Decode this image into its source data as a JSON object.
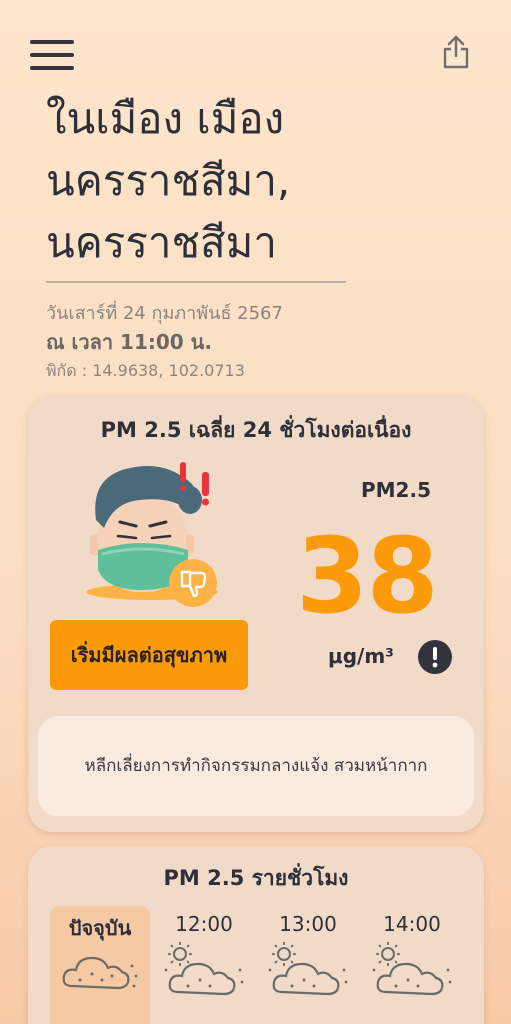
{
  "header": {
    "menu_icon": "hamburger-menu-icon",
    "share_icon": "share-icon"
  },
  "location": {
    "line1": "ในเมือง เมือง",
    "line2": "นครราชสีมา,",
    "line3": "นครราชสีมา"
  },
  "meta": {
    "date": "วันเสาร์ที่ 24 กุมภาพันธ์ 2567",
    "time": "ณ เวลา 11:00 น.",
    "coords": "พิกัด : 14.9638, 102.0713"
  },
  "pm_card": {
    "title": "PM 2.5 เฉลี่ย 24 ชั่วโมงต่อเนื่อง",
    "status": "เริ่มมีผลต่อสุขภาพ",
    "pm_label": "PM2.5",
    "value": "38",
    "unit": "μg/m³",
    "advice": "หลีกเลี่ยงการทำกิจกรรมกลางแจ้ง สวมหน้ากาก",
    "accent": "#fb9b0b",
    "face_icon": "sick-face-with-mask-icon",
    "thumb_icon": "thumbs-down-icon",
    "info_icon": "info-icon"
  },
  "hourly": {
    "title": "PM 2.5 รายชั่วโมง",
    "items": [
      {
        "label": "ปัจจุบัน",
        "icon": "dust-cloud-icon"
      },
      {
        "label": "12:00",
        "icon": "sun-dust-cloud-icon"
      },
      {
        "label": "13:00",
        "icon": "sun-dust-cloud-icon"
      },
      {
        "label": "14:00",
        "icon": "sun-dust-cloud-icon"
      }
    ]
  }
}
